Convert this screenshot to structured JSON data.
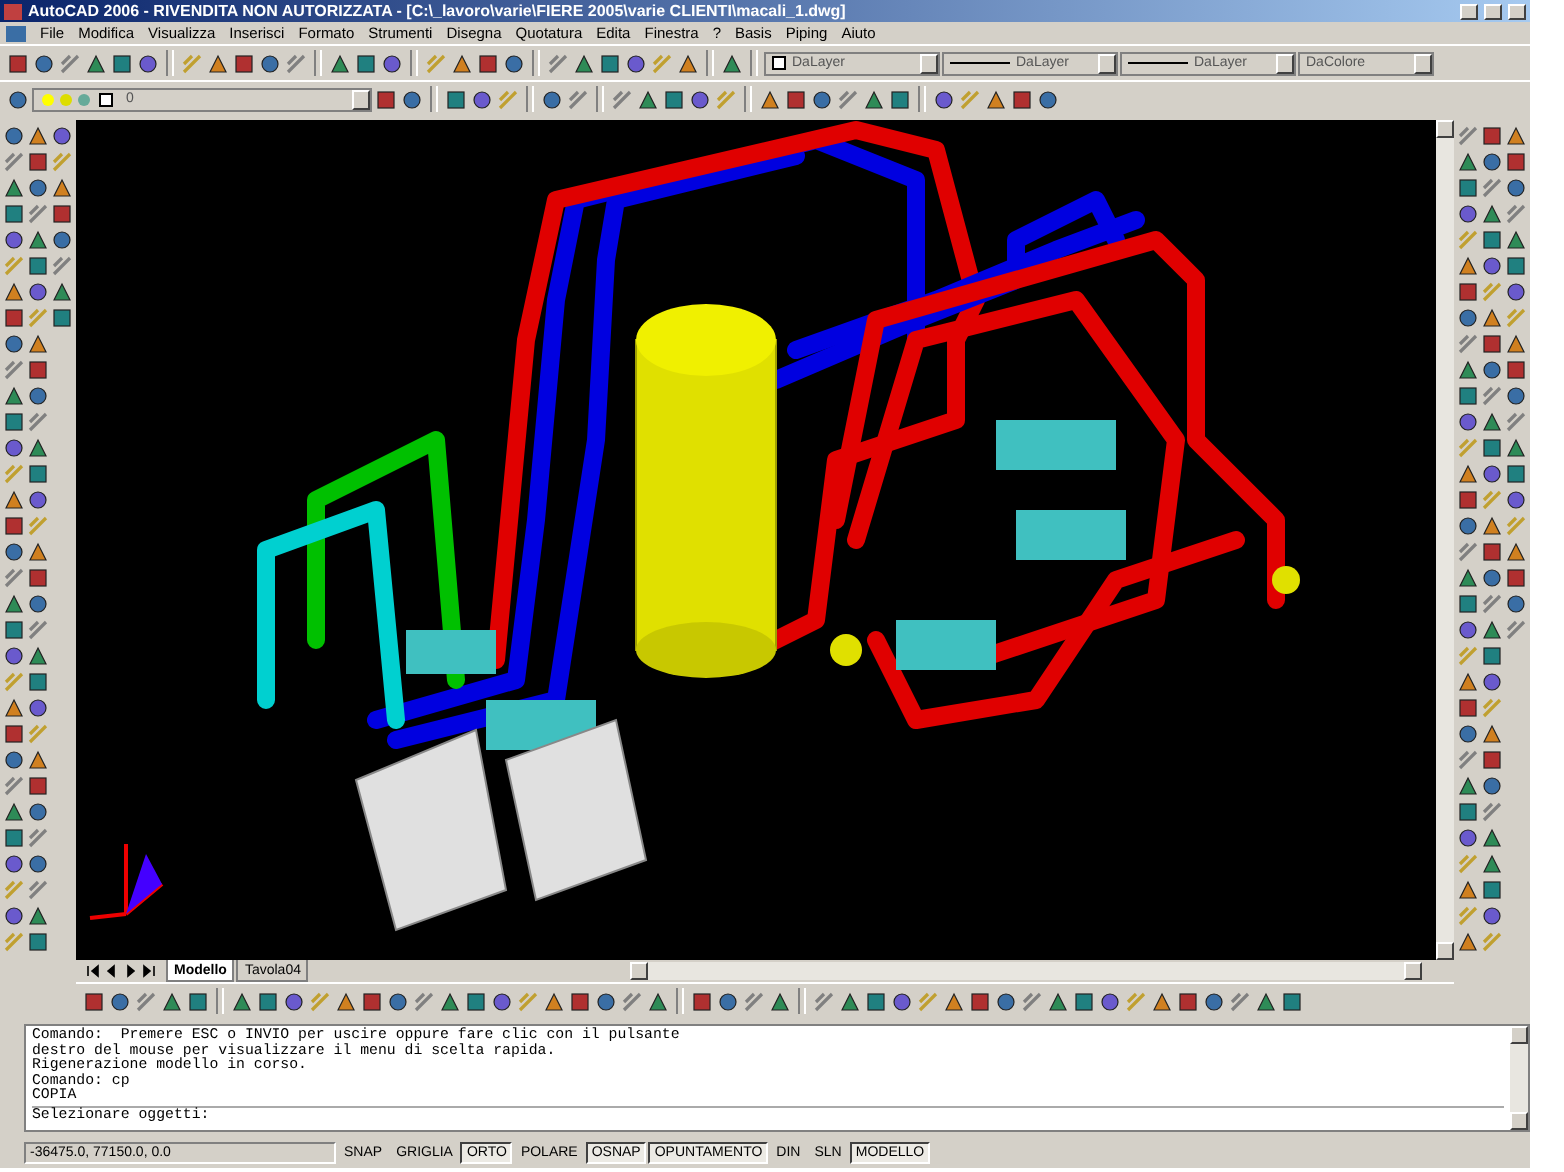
{
  "window": {
    "title": "AutoCAD 2006 - RIVENDITA NON AUTORIZZATA - [C:\\_lavoro\\varie\\FIERE 2005\\varie CLIENTI\\macali_1.dwg]"
  },
  "menu": [
    "File",
    "Modifica",
    "Visualizza",
    "Inserisci",
    "Formato",
    "Strumenti",
    "Disegna",
    "Quotatura",
    "Edita",
    "Finestra",
    "?",
    "Basis",
    "Piping",
    "Aiuto"
  ],
  "layer_combo": {
    "value": "0"
  },
  "properties": [
    {
      "value": "DaLayer",
      "kind": "color"
    },
    {
      "value": "DaLayer",
      "kind": "line"
    },
    {
      "value": "DaLayer",
      "kind": "line"
    },
    {
      "value": "DaColore",
      "kind": "plain"
    }
  ],
  "layout_tabs": [
    {
      "label": "Modello",
      "selected": true
    },
    {
      "label": "Tavola04",
      "selected": false
    }
  ],
  "command_history": [
    "Comando:  Premere ESC o INVIO per uscire oppure fare clic con il pulsante",
    "destro del mouse per visualizzare il menu di scelta rapida.",
    "Rigenerazione modello in corso.",
    "Comando: cp",
    "COPIA"
  ],
  "command_prompt": "Selezionare oggetti:",
  "status_bar": {
    "coordinates": "-36475.0, 77150.0, 0.0",
    "toggles": [
      {
        "label": "SNAP",
        "on": false
      },
      {
        "label": "GRIGLIA",
        "on": false
      },
      {
        "label": "ORTO",
        "on": true
      },
      {
        "label": "POLARE",
        "on": false
      },
      {
        "label": "OSNAP",
        "on": true
      },
      {
        "label": "OPUNTAMENTO",
        "on": true
      },
      {
        "label": "DIN",
        "on": false
      },
      {
        "label": "SLN",
        "on": false
      },
      {
        "label": "MODELLO",
        "on": true
      }
    ]
  }
}
